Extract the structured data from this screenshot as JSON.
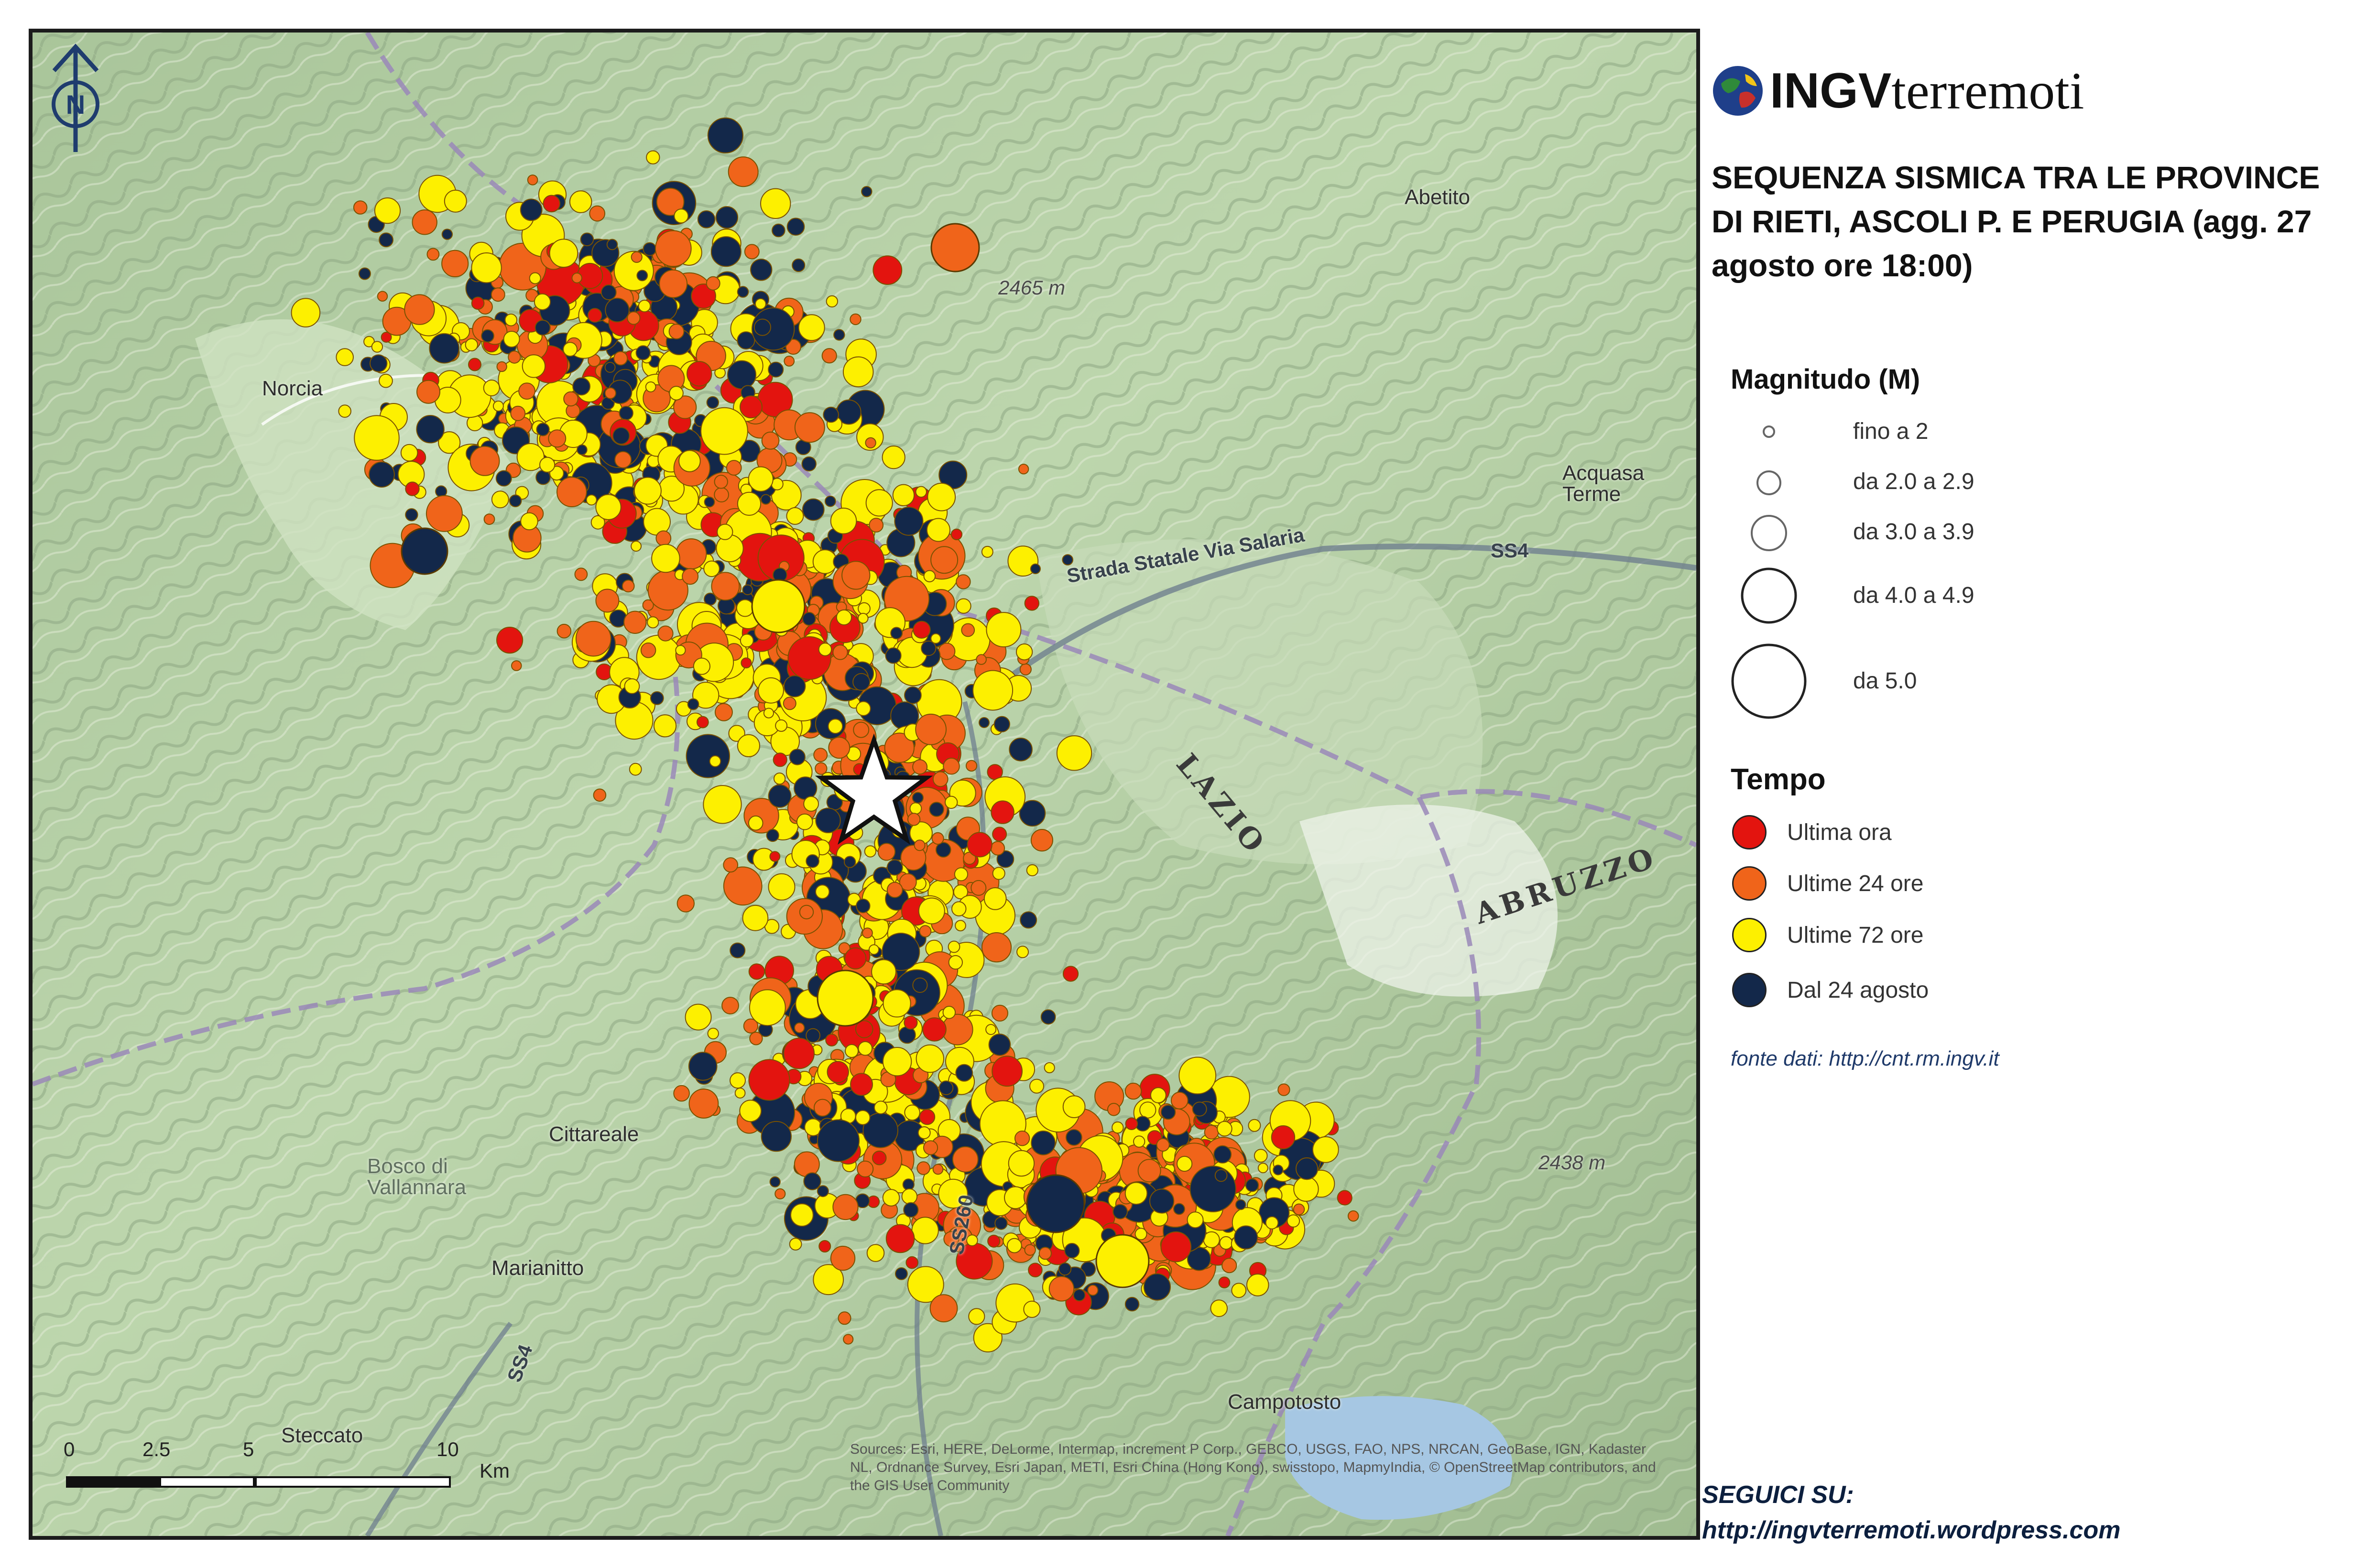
{
  "map": {
    "places": [
      {
        "id": "norcia",
        "label": "Norcia"
      },
      {
        "id": "abetito",
        "label": "Abetito"
      },
      {
        "id": "acquasanta",
        "label": "Acquasa\nTerme"
      },
      {
        "id": "cittareale",
        "label": "Cittareale"
      },
      {
        "id": "marianitto",
        "label": "Marianitto"
      },
      {
        "id": "campotosto",
        "label": "Campotosto"
      },
      {
        "id": "steccato",
        "label": "Steccato"
      },
      {
        "id": "bosco",
        "label": "Bosco di\nVallannara"
      }
    ],
    "regions": [
      {
        "id": "lazio",
        "label": "LAZIO"
      },
      {
        "id": "abruzzo",
        "label": "ABRUZZO"
      }
    ],
    "roads": [
      {
        "id": "salaria",
        "label": "Strada Statale Via Salaria"
      },
      {
        "id": "ss4-east",
        "label": "SS4"
      },
      {
        "id": "ss4-south",
        "label": "SS4"
      },
      {
        "id": "ss260",
        "label": "SS260"
      }
    ],
    "elevations": [
      {
        "id": "e2465",
        "label": "2465 m"
      },
      {
        "id": "e2438",
        "label": "2438 m"
      }
    ],
    "attribution": "Sources: Esri, HERE, DeLorme, Intermap, increment P Corp., GEBCO, USGS, FAO, NPS, NRCAN, GeoBase, IGN, Kadaster NL, Ordnance Survey, Esri Japan, METI, Esri China (Hong Kong), swisstopo, MapmyIndia, © OpenStreetMap contributors, and the GIS User Community",
    "scale": {
      "ticks": [
        "0",
        "2.5",
        "5",
        "10"
      ],
      "unit": "Km"
    },
    "north_label": "N",
    "epicenter_marker": "star-icon",
    "colors": {
      "ultima_ora": "#e3140f",
      "ultime_24": "#f0641a",
      "ultime_72": "#fdf000",
      "dal_24_agosto": "#13284a"
    }
  },
  "panel": {
    "logo": {
      "ingv": "INGV",
      "terremoti": "terremoti"
    },
    "title": "SEQUENZA SISMICA TRA LE PROVINCE DI RIETI, ASCOLI P. E PERUGIA (agg. 27 agosto ore 18:00)",
    "magnitude_legend": {
      "title": "Magnitudo (M)",
      "items": [
        {
          "label": "fino a 2"
        },
        {
          "label": "da 2.0 a 2.9"
        },
        {
          "label": "da 3.0 a 3.9"
        },
        {
          "label": "da 4.0 a 4.9"
        },
        {
          "label": "da 5.0"
        }
      ]
    },
    "time_legend": {
      "title": "Tempo",
      "items": [
        {
          "label": "Ultima ora",
          "color": "#e3140f"
        },
        {
          "label": "Ultime 24 ore",
          "color": "#f0641a"
        },
        {
          "label": "Ultime 72 ore",
          "color": "#fdf000"
        },
        {
          "label": "Dal 24 agosto",
          "color": "#13284a"
        }
      ]
    },
    "source": "fonte dati: http://cnt.rm.ingv.it",
    "follow_label": "SEGUICI SU:",
    "follow_url": "http://ingvterremoti.wordpress.com"
  }
}
